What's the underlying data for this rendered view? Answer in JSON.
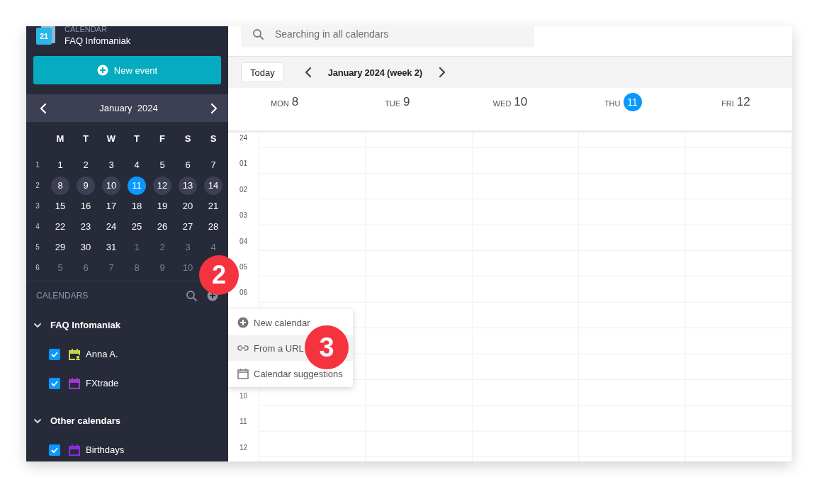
{
  "app": {
    "section_label": "CALENDAR",
    "account": "FAQ Infomaniak",
    "logo_text": "21"
  },
  "new_event_button": {
    "label": "New event"
  },
  "mini_calendar": {
    "title": "January  2024",
    "weekdays": [
      "M",
      "T",
      "W",
      "T",
      "F",
      "S",
      "S"
    ],
    "weeks": [
      {
        "number": "1",
        "days": [
          {
            "label": "1",
            "kind": "normal"
          },
          {
            "label": "2",
            "kind": "normal"
          },
          {
            "label": "3",
            "kind": "normal"
          },
          {
            "label": "4",
            "kind": "normal"
          },
          {
            "label": "5",
            "kind": "normal"
          },
          {
            "label": "6",
            "kind": "normal"
          },
          {
            "label": "7",
            "kind": "normal"
          }
        ]
      },
      {
        "number": "2",
        "days": [
          {
            "label": "8",
            "kind": "week"
          },
          {
            "label": "9",
            "kind": "week"
          },
          {
            "label": "10",
            "kind": "week"
          },
          {
            "label": "11",
            "kind": "today"
          },
          {
            "label": "12",
            "kind": "week"
          },
          {
            "label": "13",
            "kind": "week"
          },
          {
            "label": "14",
            "kind": "week"
          }
        ]
      },
      {
        "number": "3",
        "days": [
          {
            "label": "15",
            "kind": "normal"
          },
          {
            "label": "16",
            "kind": "normal"
          },
          {
            "label": "17",
            "kind": "normal"
          },
          {
            "label": "18",
            "kind": "normal"
          },
          {
            "label": "19",
            "kind": "normal"
          },
          {
            "label": "20",
            "kind": "normal"
          },
          {
            "label": "21",
            "kind": "normal"
          }
        ]
      },
      {
        "number": "4",
        "days": [
          {
            "label": "22",
            "kind": "normal"
          },
          {
            "label": "23",
            "kind": "normal"
          },
          {
            "label": "24",
            "kind": "normal"
          },
          {
            "label": "25",
            "kind": "normal"
          },
          {
            "label": "26",
            "kind": "normal"
          },
          {
            "label": "27",
            "kind": "normal"
          },
          {
            "label": "28",
            "kind": "normal"
          }
        ]
      },
      {
        "number": "5",
        "days": [
          {
            "label": "29",
            "kind": "normal"
          },
          {
            "label": "30",
            "kind": "normal"
          },
          {
            "label": "31",
            "kind": "normal"
          },
          {
            "label": "1",
            "kind": "outside"
          },
          {
            "label": "2",
            "kind": "outside"
          },
          {
            "label": "3",
            "kind": "outside"
          },
          {
            "label": "4",
            "kind": "outside"
          }
        ]
      },
      {
        "number": "6",
        "days": [
          {
            "label": "5",
            "kind": "outside"
          },
          {
            "label": "6",
            "kind": "outside"
          },
          {
            "label": "7",
            "kind": "outside"
          },
          {
            "label": "8",
            "kind": "outside"
          },
          {
            "label": "9",
            "kind": "outside"
          },
          {
            "label": "10",
            "kind": "outside"
          }
        ]
      }
    ]
  },
  "calendars": {
    "title": "CALENDARS",
    "groups": [
      {
        "name": "FAQ Infomaniak",
        "expanded": true,
        "items": [
          {
            "name": "Anna A.",
            "checked": true,
            "color": "#c8d64c",
            "kind": "shared"
          },
          {
            "name": "FXtrade",
            "checked": true,
            "color": "#a03ccf",
            "kind": "own"
          }
        ]
      },
      {
        "name": "Other calendars",
        "expanded": true,
        "items": [
          {
            "name": "Birthdays",
            "checked": true,
            "color": "#8c2be6",
            "kind": "own"
          }
        ]
      }
    ]
  },
  "search": {
    "placeholder": "Searching in all calendars"
  },
  "toolbar": {
    "today_button": "Today",
    "title": "January 2024 (week 2)"
  },
  "week_days": [
    {
      "weekday": "MON",
      "date": "8",
      "selected": false
    },
    {
      "weekday": "TUE",
      "date": "9",
      "selected": false
    },
    {
      "weekday": "WED",
      "date": "10",
      "selected": false
    },
    {
      "weekday": "THU",
      "date": "11",
      "selected": true
    },
    {
      "weekday": "FRI",
      "date": "12",
      "selected": false
    }
  ],
  "hours_above_menu": [
    "24",
    "01",
    "02",
    "03",
    "04",
    "05",
    "06"
  ],
  "hours_below_menu": [
    "10",
    "11",
    "12"
  ],
  "add_menu": {
    "items": [
      {
        "label": "New calendar",
        "kind": "new",
        "selected": false
      },
      {
        "label": "From a URL",
        "kind": "url",
        "selected": true
      },
      {
        "label": "Calendar suggestions",
        "kind": "suggest",
        "selected": false
      }
    ]
  },
  "annotations": [
    {
      "label": "2"
    },
    {
      "label": "3"
    }
  ]
}
